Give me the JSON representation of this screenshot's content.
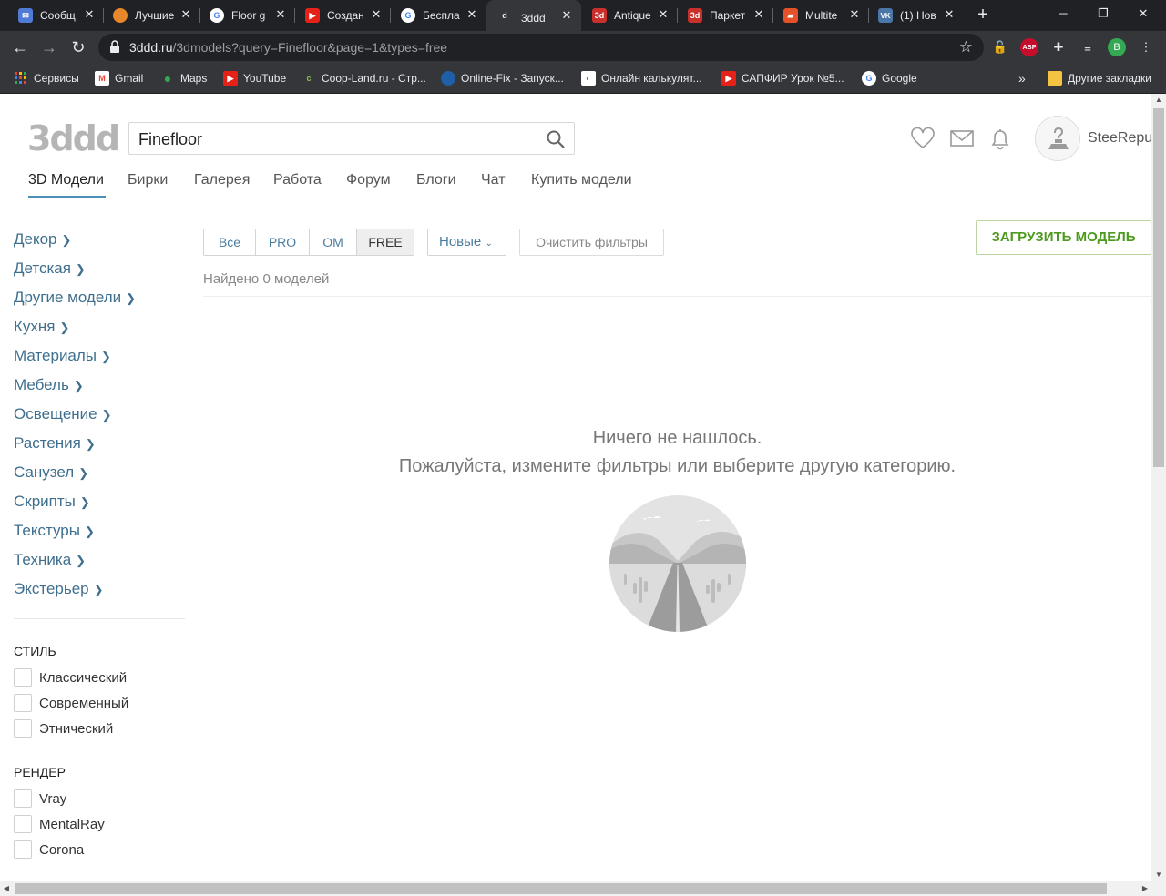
{
  "browser": {
    "tabs": [
      {
        "title": "Сообщ",
        "icon": "messenger-icon",
        "color": "#4f7bd6"
      },
      {
        "title": "Лучшие",
        "icon": "orange-globe-icon",
        "color": "#e8872a"
      },
      {
        "title": "Floor g",
        "icon": "google-icon",
        "color": "#ffffff"
      },
      {
        "title": "Создан",
        "icon": "youtube-icon",
        "color": "#e62117"
      },
      {
        "title": "Беспла",
        "icon": "google-icon",
        "color": "#ffffff"
      },
      {
        "title": "3ddd",
        "icon": "3ddd-icon",
        "color": "#35363a",
        "active": true
      },
      {
        "title": "Antique",
        "icon": "3dd-red-icon",
        "color": "#c9302c"
      },
      {
        "title": "Паркет",
        "icon": "3dd-red-icon",
        "color": "#c9302c"
      },
      {
        "title": "Multite",
        "icon": "multitex-icon",
        "color": "#e5522a"
      },
      {
        "title": "(1) Нов",
        "icon": "vk-icon",
        "color": "#4a76a8"
      }
    ],
    "url_host": "3ddd.ru",
    "url_path": "/3dmodels?query=Finefloor&page=1&types=free",
    "profile_initial": "B",
    "abp_label": "ABP",
    "bookmarks": [
      {
        "label": "Сервисы",
        "icon": "apps-grid-icon"
      },
      {
        "label": "Gmail",
        "icon": "gmail-icon"
      },
      {
        "label": "Maps",
        "icon": "maps-pin-icon"
      },
      {
        "label": "YouTube",
        "icon": "youtube-icon"
      },
      {
        "label": "Coop-Land.ru - Стр...",
        "icon": "coop-land-icon"
      },
      {
        "label": "Online-Fix - Запуск...",
        "icon": "online-fix-icon"
      },
      {
        "label": "Онлайн калькулят...",
        "icon": "calculator-icon"
      },
      {
        "label": "САПФИР Урок №5...",
        "icon": "youtube-icon"
      },
      {
        "label": "Google",
        "icon": "google-icon"
      }
    ],
    "other_bookmarks": "Другие закладки"
  },
  "site": {
    "logo": "3ddd",
    "search_value": "Finefloor",
    "username": "SteeRepub",
    "nav": [
      "3D Модели",
      "Бирки",
      "Галерея",
      "Работа",
      "Форум",
      "Блоги",
      "Чат",
      "Купить модели"
    ],
    "categories": [
      "Декор",
      "Детская",
      "Другие модели",
      "Кухня",
      "Материалы",
      "Мебель",
      "Освещение",
      "Растения",
      "Санузел",
      "Скрипты",
      "Текстуры",
      "Техника",
      "Экстерьер"
    ],
    "style_filter": {
      "title": "СТИЛЬ",
      "options": [
        "Классический",
        "Современный",
        "Этнический"
      ]
    },
    "render_filter": {
      "title": "РЕНДЕР",
      "options": [
        "Vray",
        "MentalRay",
        "Corona"
      ]
    },
    "type_tabs": [
      "Все",
      "PRO",
      "OM",
      "FREE"
    ],
    "active_type": "FREE",
    "sort_label": "Новые",
    "clear_filters": "Очистить фильтры",
    "upload_button": "ЗАГРУЗИТЬ МОДЕЛЬ",
    "found_text": "Найдено 0 моделей",
    "empty_title": "Ничего не нашлось.",
    "empty_subtitle": "Пожалуйста, измените фильтры или выберите другую категорию.",
    "colors": {
      "link": "#3f6f8e",
      "upload_green": "#4d9a1f",
      "nav_active_underline": "#4a90b8"
    }
  }
}
